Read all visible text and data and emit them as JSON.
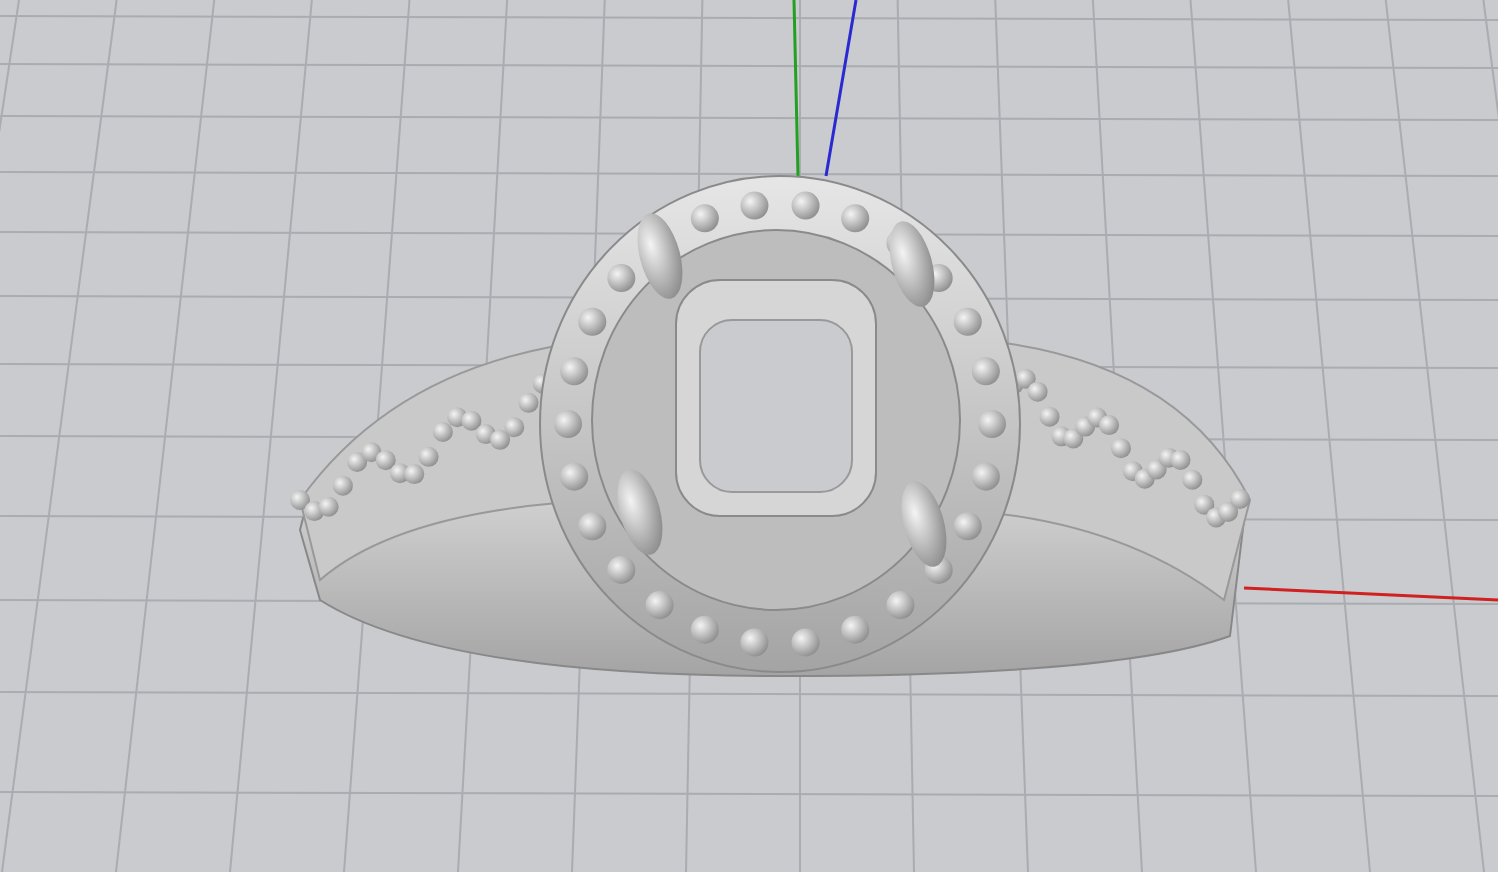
{
  "viewport": {
    "axes": [
      {
        "kind": "y",
        "color": "#22a022"
      },
      {
        "kind": "z",
        "color": "#2a2ad0"
      },
      {
        "kind": "x",
        "color": "#d02020"
      }
    ]
  }
}
